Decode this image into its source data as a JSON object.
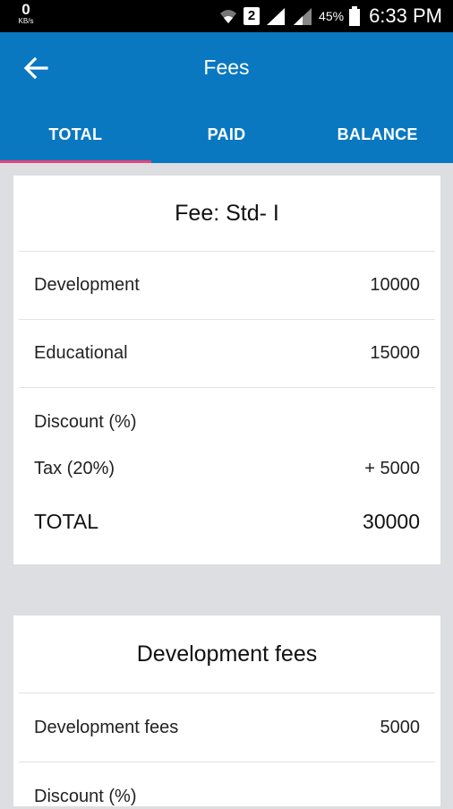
{
  "status_bar": {
    "speed_value": "0",
    "speed_unit": "KB/s",
    "sim": "2",
    "battery": "45%",
    "time": "6:33 PM"
  },
  "appbar": {
    "title": "Fees",
    "tabs": [
      {
        "label": "TOTAL",
        "active": true
      },
      {
        "label": "PAID",
        "active": false
      },
      {
        "label": "BALANCE",
        "active": false
      }
    ]
  },
  "card1": {
    "title": "Fee: Std- I",
    "rows": [
      {
        "label": "Development",
        "value": "10000"
      },
      {
        "label": "Educational",
        "value": "15000"
      }
    ],
    "discount_label": "Discount (%)",
    "tax": {
      "label": "Tax (20%)",
      "value": "+ 5000"
    },
    "total": {
      "label": "TOTAL",
      "value": "30000"
    }
  },
  "card2": {
    "title": "Development fees",
    "rows": [
      {
        "label": "Development fees",
        "value": "5000"
      }
    ],
    "discount_label": "Discount (%)"
  },
  "colors": {
    "appbar": "#0a78c0",
    "tab_indicator": "#e8457c",
    "background": "#dcdee1"
  }
}
